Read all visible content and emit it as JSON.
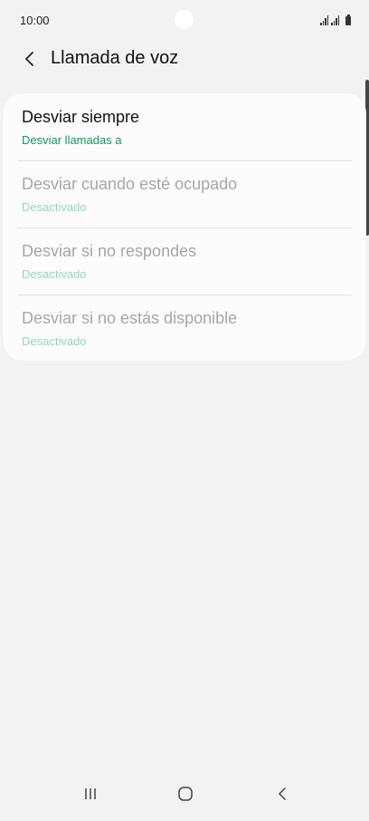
{
  "status_bar": {
    "time": "10:00"
  },
  "app_bar": {
    "title": "Llamada de voz",
    "back_icon": "chevron-left-icon"
  },
  "forwarding_options": [
    {
      "title": "Desviar siempre",
      "subtitle": "Desviar llamadas a",
      "enabled": true
    },
    {
      "title": "Desviar cuando esté ocupado",
      "subtitle": "Desactivado",
      "enabled": false
    },
    {
      "title": "Desviar si no respondes",
      "subtitle": "Desactivado",
      "enabled": false
    },
    {
      "title": "Desviar si no estás disponible",
      "subtitle": "Desactivado",
      "enabled": false
    }
  ],
  "nav_bar": {
    "recent_icon": "recent-apps-icon",
    "home_icon": "home-icon",
    "back_icon": "back-icon"
  },
  "colors": {
    "background": "#f2f2f2",
    "card": "#fcfcfc",
    "accent_green": "#17965a",
    "accent_green_disabled": "#97d6b6",
    "text_disabled": "#a6a6a6"
  }
}
